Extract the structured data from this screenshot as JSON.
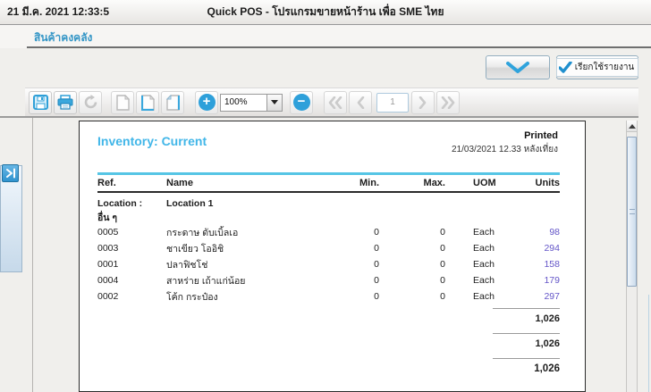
{
  "titlebar": {
    "datetime": "21 มี.ค. 2021 12:33:5",
    "title": "Quick POS - โปรแกรมขายหน้าร้าน เพื่อ SME ไทย"
  },
  "nav": {
    "inventory_tab": "สินค้าคงคลัง"
  },
  "actions": {
    "run_report_label": "เรียกใช้รายงาน"
  },
  "toolbar": {
    "zoom_level": "100%",
    "page_number": "1",
    "zoom_in_glyph": "+",
    "zoom_out_glyph": "−"
  },
  "report": {
    "title": "Inventory: Current",
    "printed_label": "Printed",
    "printed_datetime": "21/03/2021 12.33 หลังเที่ยง",
    "columns": [
      "Ref.",
      "Name",
      "Min.",
      "Max.",
      "UOM",
      "Units"
    ],
    "location_label": "Location :",
    "location_value": "Location 1",
    "category": "อื่น ๆ",
    "rows": [
      {
        "ref": "0005",
        "name": "กระดาษ ดับเบิ้ลเอ",
        "min": "0",
        "max": "0",
        "uom": "Each",
        "units": "98"
      },
      {
        "ref": "0003",
        "name": "ชาเขียว โออิชิ",
        "min": "0",
        "max": "0",
        "uom": "Each",
        "units": "294"
      },
      {
        "ref": "0001",
        "name": "ปลาฟิชโช่",
        "min": "0",
        "max": "0",
        "uom": "Each",
        "units": "158"
      },
      {
        "ref": "0004",
        "name": "สาหร่าย เถ้าแก่น้อย",
        "min": "0",
        "max": "0",
        "uom": "Each",
        "units": "179"
      },
      {
        "ref": "0002",
        "name": "โค้ก กระป๋อง",
        "min": "0",
        "max": "0",
        "uom": "Each",
        "units": "297"
      }
    ],
    "totals": [
      "1,026",
      "1,026",
      "1,026"
    ]
  },
  "colors": {
    "accent_blue": "#2fa3dc",
    "report_title_blue": "#41b6e8",
    "table_top_border": "#55c5e5",
    "units_link_purple": "#6456c8"
  }
}
